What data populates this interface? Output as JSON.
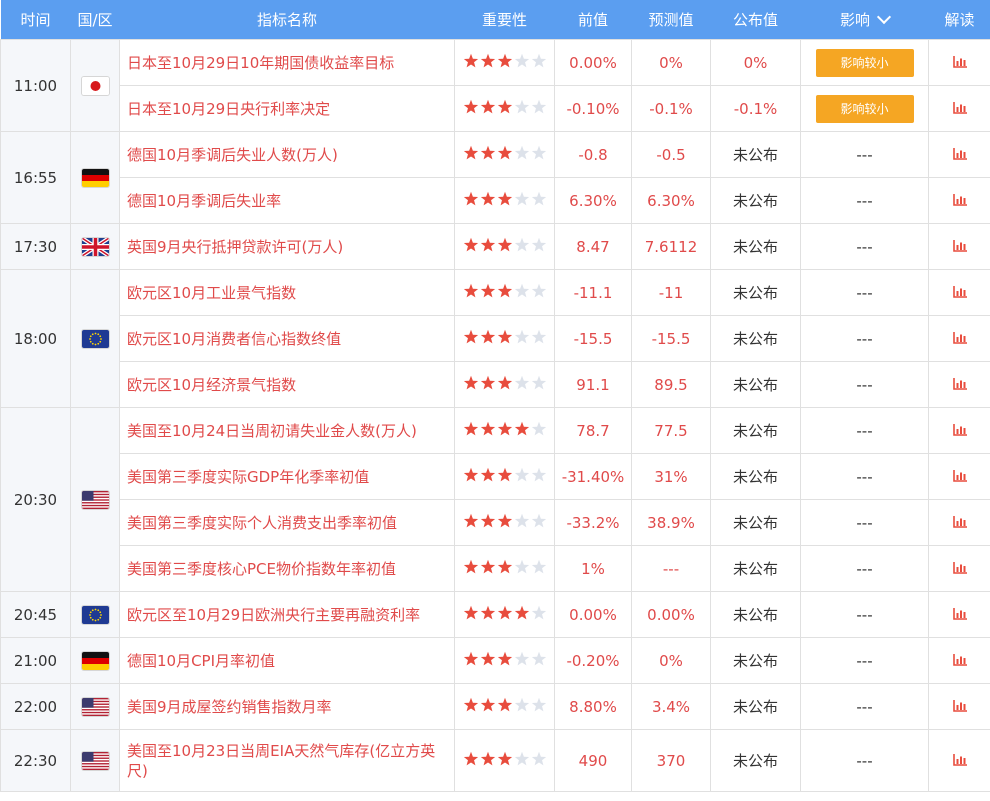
{
  "header": {
    "time": "时间",
    "region": "国/区",
    "name": "指标名称",
    "importance": "重要性",
    "previous": "前值",
    "forecast": "预测值",
    "actual": "公布值",
    "impact": "影响",
    "interpret": "解读"
  },
  "colors": {
    "header_bg": "#5b9ef0",
    "star_on": "#e84c3d",
    "star_off": "#dde2ea",
    "impact_badge": "#f5a623",
    "indicator_text": "#e04a4a"
  },
  "groups": [
    {
      "time": "11:00",
      "flag": "japan",
      "rows": [
        {
          "name": "日本至10月29日10年期国债收益率目标",
          "stars": 3,
          "previous": "0.00%",
          "forecast": "0%",
          "actual": "0%",
          "impact": "影响较小"
        },
        {
          "name": "日本至10月29日央行利率决定",
          "stars": 3,
          "previous": "-0.10%",
          "forecast": "-0.1%",
          "actual": "-0.1%",
          "impact": "影响较小"
        }
      ]
    },
    {
      "time": "16:55",
      "flag": "germany",
      "rows": [
        {
          "name": "德国10月季调后失业人数(万人)",
          "stars": 3,
          "previous": "-0.8",
          "forecast": "-0.5",
          "actual": "未公布",
          "impact": "---"
        },
        {
          "name": "德国10月季调后失业率",
          "stars": 3,
          "previous": "6.30%",
          "forecast": "6.30%",
          "actual": "未公布",
          "impact": "---"
        }
      ]
    },
    {
      "time": "17:30",
      "flag": "uk",
      "rows": [
        {
          "name": "英国9月央行抵押贷款许可(万人)",
          "stars": 3,
          "previous": "8.47",
          "forecast": "7.6112",
          "actual": "未公布",
          "impact": "---"
        }
      ]
    },
    {
      "time": "18:00",
      "flag": "eu",
      "rows": [
        {
          "name": "欧元区10月工业景气指数",
          "stars": 3,
          "previous": "-11.1",
          "forecast": "-11",
          "actual": "未公布",
          "impact": "---"
        },
        {
          "name": "欧元区10月消费者信心指数终值",
          "stars": 3,
          "previous": "-15.5",
          "forecast": "-15.5",
          "actual": "未公布",
          "impact": "---"
        },
        {
          "name": "欧元区10月经济景气指数",
          "stars": 3,
          "previous": "91.1",
          "forecast": "89.5",
          "actual": "未公布",
          "impact": "---"
        }
      ]
    },
    {
      "time": "20:30",
      "flag": "usa",
      "rows": [
        {
          "name": "美国至10月24日当周初请失业金人数(万人)",
          "stars": 4,
          "previous": "78.7",
          "forecast": "77.5",
          "actual": "未公布",
          "impact": "---"
        },
        {
          "name": "美国第三季度实际GDP年化季率初值",
          "stars": 3,
          "previous": "-31.40%",
          "forecast": "31%",
          "actual": "未公布",
          "impact": "---"
        },
        {
          "name": "美国第三季度实际个人消费支出季率初值",
          "stars": 3,
          "previous": "-33.2%",
          "forecast": "38.9%",
          "actual": "未公布",
          "impact": "---"
        },
        {
          "name": "美国第三季度核心PCE物价指数年率初值",
          "stars": 3,
          "previous": "1%",
          "forecast": "---",
          "actual": "未公布",
          "impact": "---"
        }
      ]
    },
    {
      "time": "20:45",
      "flag": "eu",
      "rows": [
        {
          "name": "欧元区至10月29日欧洲央行主要再融资利率",
          "stars": 4,
          "previous": "0.00%",
          "forecast": "0.00%",
          "actual": "未公布",
          "impact": "---"
        }
      ]
    },
    {
      "time": "21:00",
      "flag": "germany",
      "rows": [
        {
          "name": "德国10月CPI月率初值",
          "stars": 3,
          "previous": "-0.20%",
          "forecast": "0%",
          "actual": "未公布",
          "impact": "---"
        }
      ]
    },
    {
      "time": "22:00",
      "flag": "usa",
      "rows": [
        {
          "name": "美国9月成屋签约销售指数月率",
          "stars": 3,
          "previous": "8.80%",
          "forecast": "3.4%",
          "actual": "未公布",
          "impact": "---"
        }
      ]
    },
    {
      "time": "22:30",
      "flag": "usa",
      "rows": [
        {
          "name": "美国至10月23日当周EIA天然气库存(亿立方英尺)",
          "stars": 3,
          "previous": "490",
          "forecast": "370",
          "actual": "未公布",
          "impact": "---"
        }
      ]
    }
  ]
}
